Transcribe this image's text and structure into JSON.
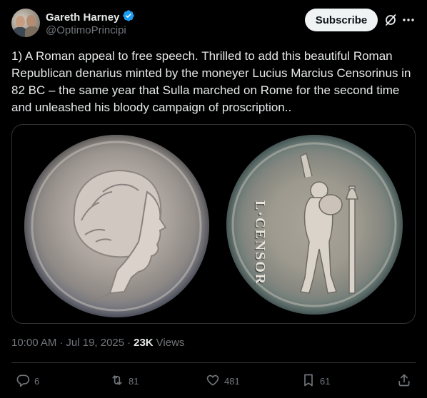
{
  "author": {
    "display_name": "Gareth Harney",
    "handle": "@OptimoPrincipi",
    "verified": true,
    "avatar_icon": "avatar-photo"
  },
  "header": {
    "subscribe_label": "Subscribe",
    "grok_icon": "grok-icon",
    "more_icon": "more-icon"
  },
  "tweet": {
    "text": "1) A Roman appeal to free speech. Thrilled to add this beautiful Roman Republican denarius minted by the moneyer Lucius Marcius Censorinus in 82 BC – the same year that Sulla marched on Rome for the second time and unleashed his bloody campaign of proscription..",
    "reverse_legend": "L·CENSOR"
  },
  "meta": {
    "time": "10:00 AM",
    "sep1": "·",
    "date": "Jul 19, 2025",
    "sep2": "·",
    "views_count": "23K",
    "views_label": "Views"
  },
  "actions": {
    "replies": "6",
    "reposts": "81",
    "likes": "481",
    "bookmarks": "61"
  },
  "colors": {
    "background": "#000000",
    "text_primary": "#e7e9ea",
    "text_secondary": "#71767b",
    "verified_blue": "#1d9bf0",
    "divider": "#2f3336"
  }
}
